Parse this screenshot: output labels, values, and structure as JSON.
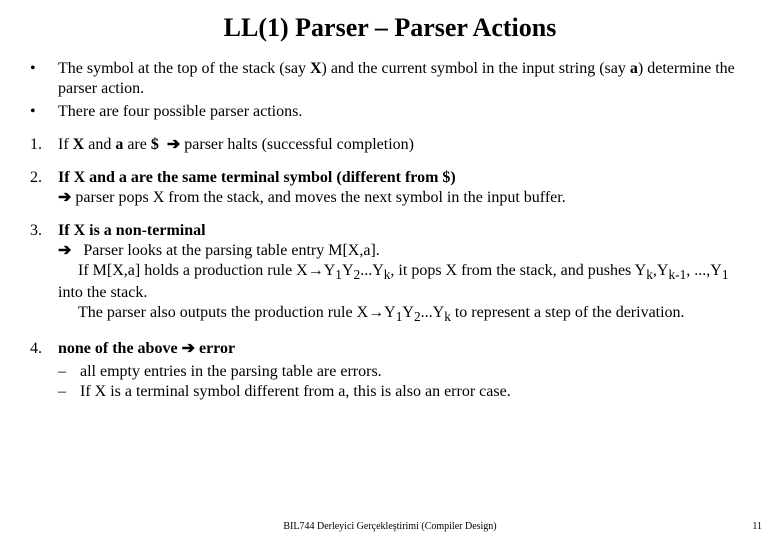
{
  "title": "LL(1) Parser – Parser Actions",
  "b1a": "The symbol at the top of the stack (say ",
  "b1_X": "X",
  "b1b": ") and the current symbol in the input string (say ",
  "b1_a": "a",
  "b1c": ") determine the parser action.",
  "b2": "There are four possible parser actions.",
  "m1": "1.",
  "p1a": "If ",
  "p1X": "X",
  "p1b": " and ",
  "p1a2": "a",
  "p1c": " are ",
  "p1d": "$",
  "arrow": "➔",
  "p1e": " parser halts (successful completion)",
  "m2": "2.",
  "p2a": "If ",
  "p2X": "X",
  "p2b": " and ",
  "p2a2": "a",
  "p2c": " are the same terminal symbol (different from $)",
  "p2d": " parser pops ",
  "p2e": " from the stack, and moves the next symbol in the input buffer.",
  "m3": "3.",
  "p3a": "If ",
  "p3X": "X",
  "p3b": " is a non-terminal",
  "p3c": "Parser looks at the parsing table entry M[X,a].",
  "p3d": "If M[X,a] holds a production rule   X",
  "rarr": "→",
  "p3Y1": "Y",
  "sub1": "1",
  "p3Y2": "Y",
  "sub2": "2",
  "p3dots": "...Y",
  "subk": "k",
  "p3e": ", it pops X from the stack, and pushes Y",
  "p3f": ",Y",
  "subk1": "k-1",
  "p3g": ", ...,Y",
  "p3h": " into the stack.",
  "p3i": "The parser also outputs the production rule X",
  "p3j": " to represent a step of the derivation.",
  "m4": "4.",
  "p4a": "none of the above  ",
  "p4b": "   error",
  "s1": "all empty entries in the parsing table are errors.",
  "s2": "If X is a terminal symbol different from a, this is also an error case.",
  "footer": "BIL744 Derleyici Gerçekleştirimi (Compiler Design)",
  "page": "11",
  "dash": "–",
  "bullet": "•"
}
